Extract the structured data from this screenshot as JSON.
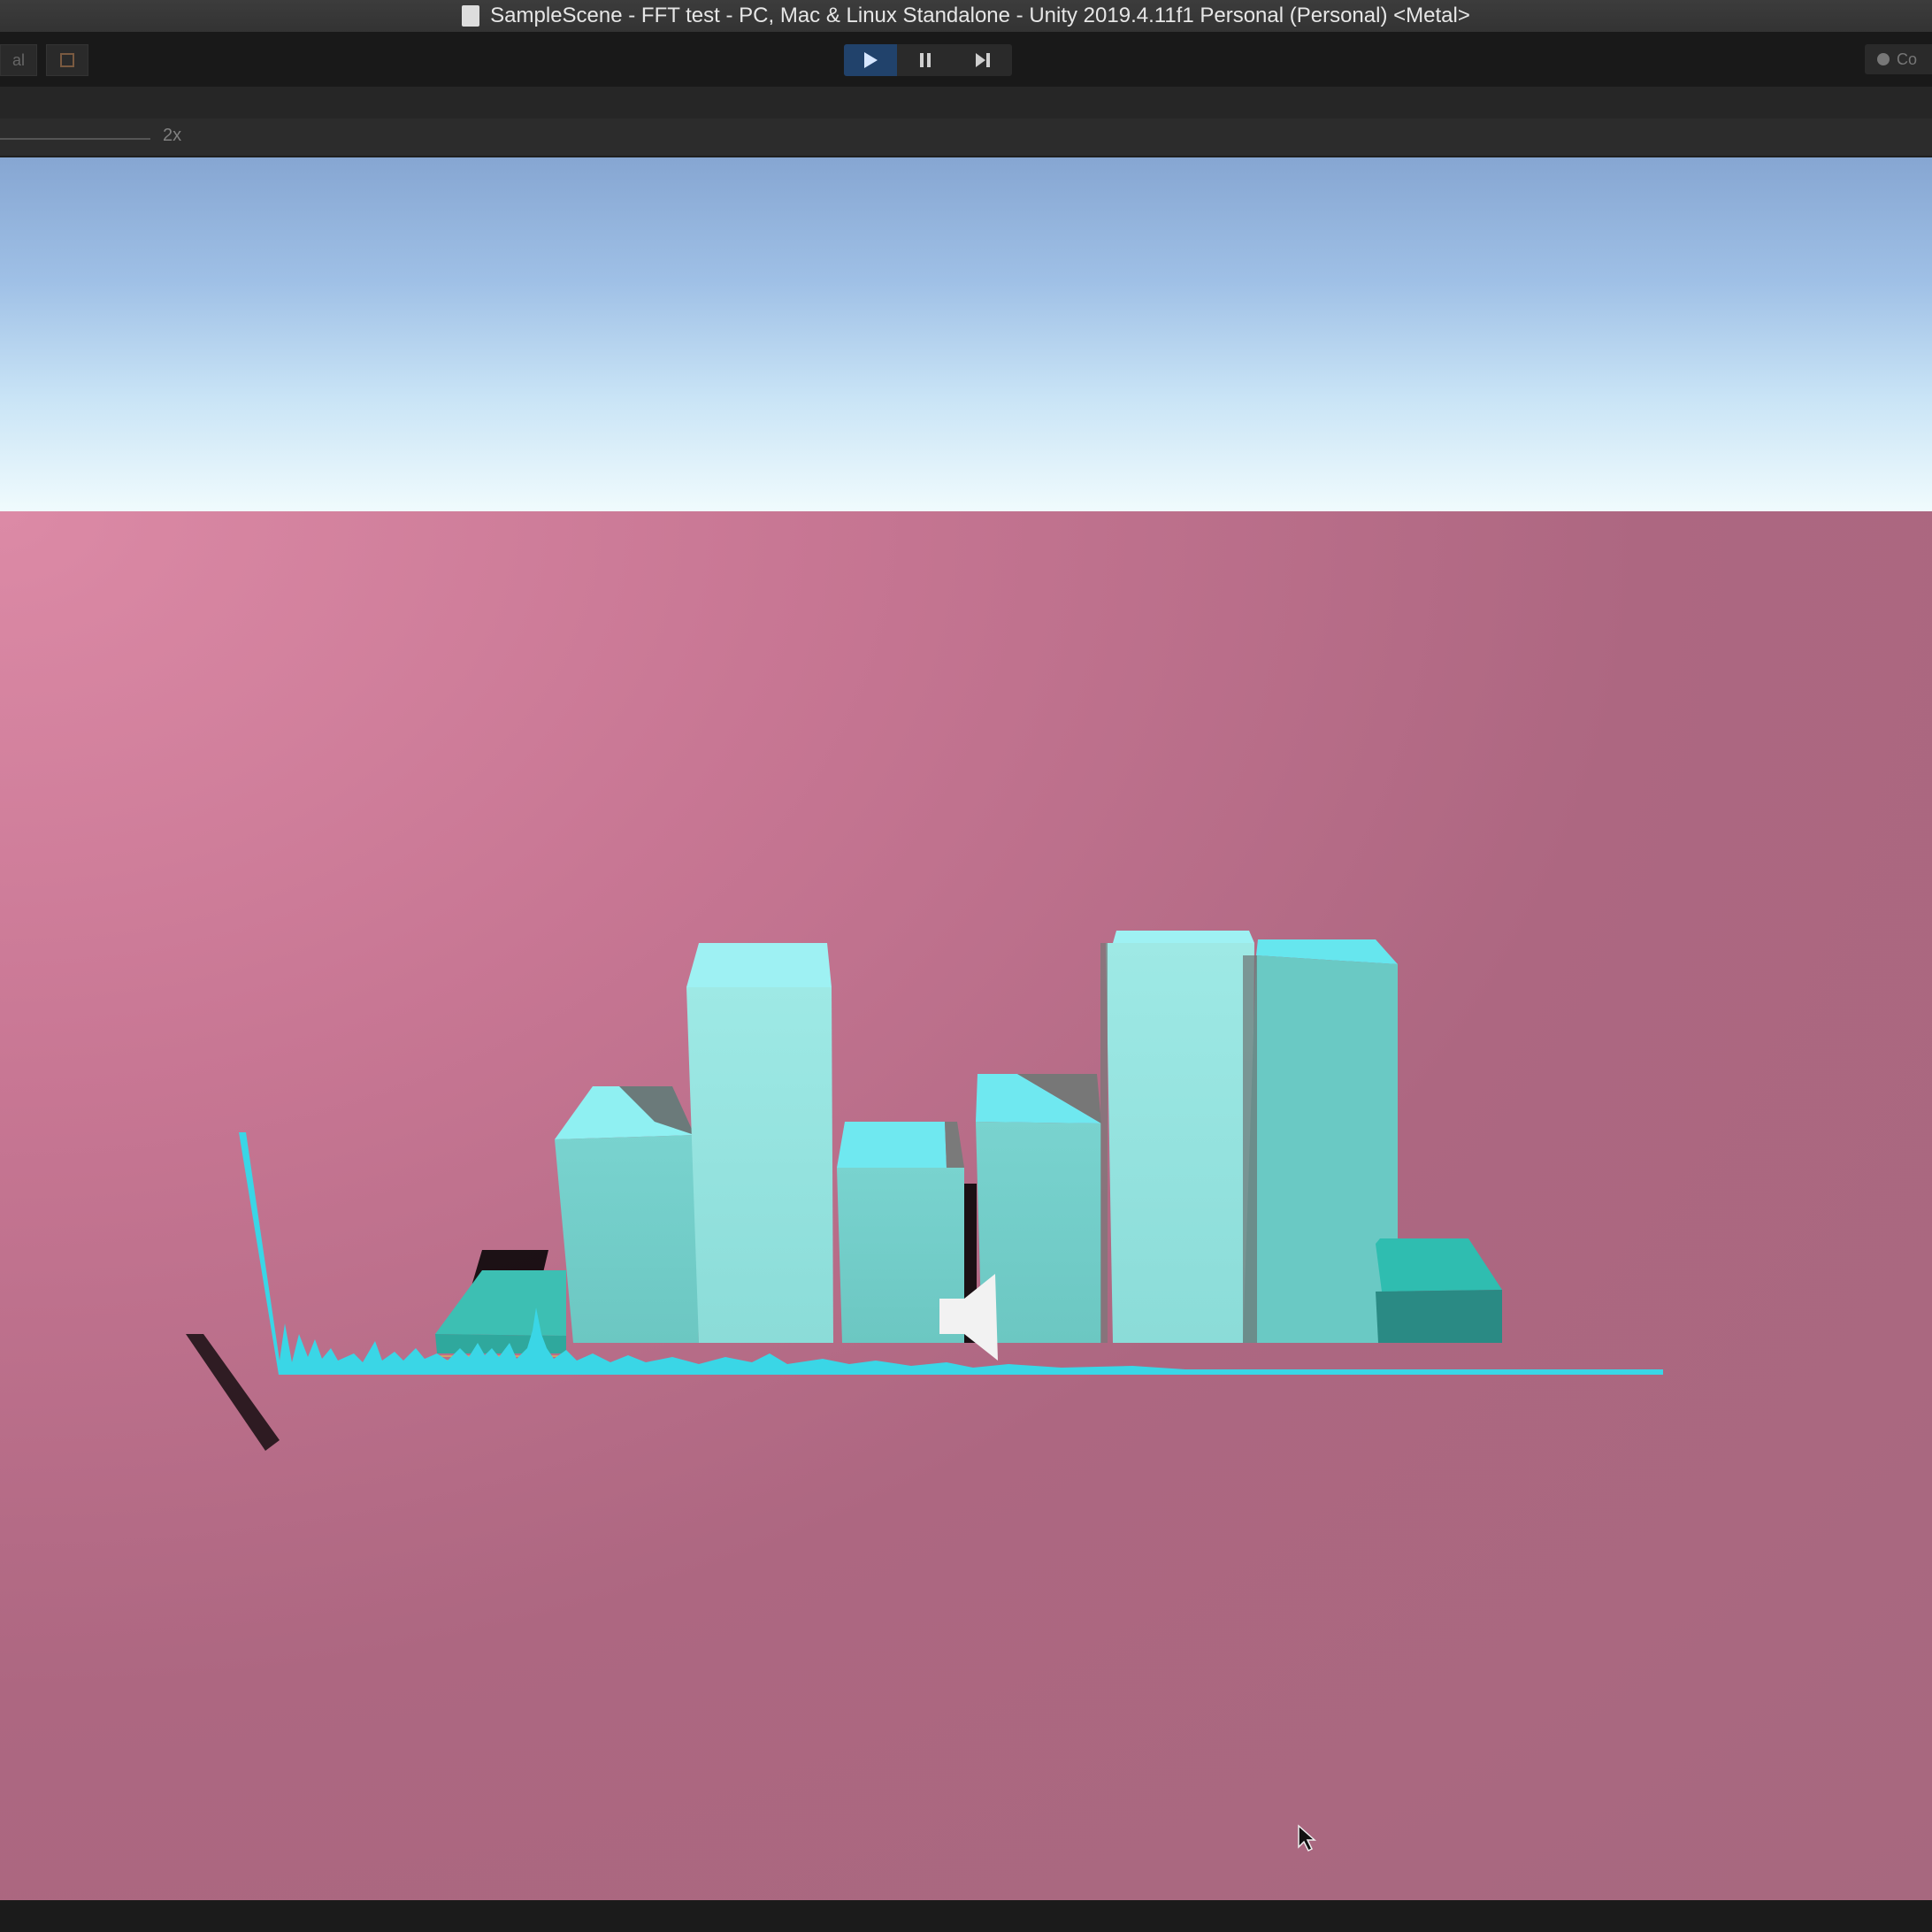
{
  "window": {
    "title": "SampleScene - FFT test - PC, Mac & Linux Standalone - Unity 2019.4.11f1 Personal (Personal) <Metal>",
    "doc_icon": "document-icon"
  },
  "toolbar": {
    "left_partial_label": "al",
    "play_icon": "play-icon",
    "pause_icon": "pause-icon",
    "step_icon": "step-icon",
    "play_active": true,
    "collab_label": "Co"
  },
  "game_view": {
    "scale_label": "2x"
  },
  "scene": {
    "sky_colors": [
      "#86a6d2",
      "#c9e4f6",
      "#f0fbfd"
    ],
    "ground_color": "#b86b86",
    "bar_color": "#8ae0de",
    "spectrum_color": "#3ad6e6",
    "audio_source_icon": "speaker-icon",
    "cursor_icon": "mouse-cursor-icon"
  }
}
